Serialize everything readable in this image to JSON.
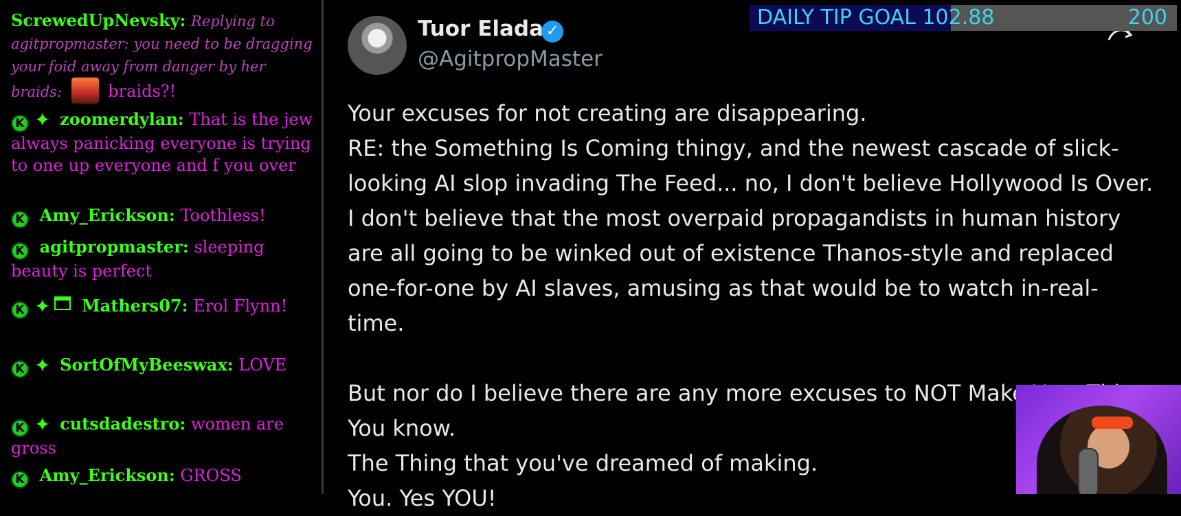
{
  "chat": {
    "messages": [
      {
        "nick": "ScrewedUpNevsky:",
        "reply": "Replying to agitpropmaster: you need to be dragging your foid away from danger by her braids:",
        "text": "braids?!"
      },
      {
        "badge": "K",
        "nick": "zoomerdylan:",
        "text": "That is the jew always panicking everyone is trying to one up everyone and f you over"
      },
      {
        "badge": "K",
        "nick": "Amy_Erickson:",
        "text": "Toothless!"
      },
      {
        "badge": "K",
        "nick": "agitpropmaster:",
        "text": "sleeping beauty is perfect"
      },
      {
        "badge": "K",
        "nick": "Mathers07:",
        "text": "Erol Flynn!"
      },
      {
        "badge": "K",
        "nick": "SortOfMyBeeswax:",
        "text": "LOVE"
      },
      {
        "badge": "K",
        "nick": "cutsdadestro:",
        "text": "women are gross"
      },
      {
        "badge": "K",
        "nick": "Amy_Erickson:",
        "text": "GROSS"
      }
    ],
    "sparkle_glyph": "✦"
  },
  "tweet": {
    "display_name": "Tuor Eladar",
    "verified_glyph": "✓",
    "handle": "@AgitpropMaster",
    "lines": [
      "Your excuses for not creating are disappearing.",
      "RE: the Something Is Coming thingy, and the newest cascade of slick-",
      "looking AI slop invading The Feed... no, I don't believe Hollywood Is Over.",
      "I don't believe that the most overpaid propagandists in human history",
      "are all going to be winked out of existence Thanos-style and replaced",
      "one-for-one by AI slaves, amusing as that would be to watch in-real-",
      "time.",
      "",
      "But nor do I believe there are any more excuses to NOT Make Your Thing.",
      "You know.",
      "The Thing that you've dreamed of making.",
      "You. Yes YOU!"
    ]
  },
  "tip_goal": {
    "label": "DAILY TIP GOAL",
    "current": "102.88",
    "target": "200",
    "progress_fraction": 0.4714
  },
  "colors": {
    "nick": "#39ff14",
    "message_text": "#e020e0",
    "tip_text": "#3fd3f0",
    "verified": "#1d9bf0"
  }
}
